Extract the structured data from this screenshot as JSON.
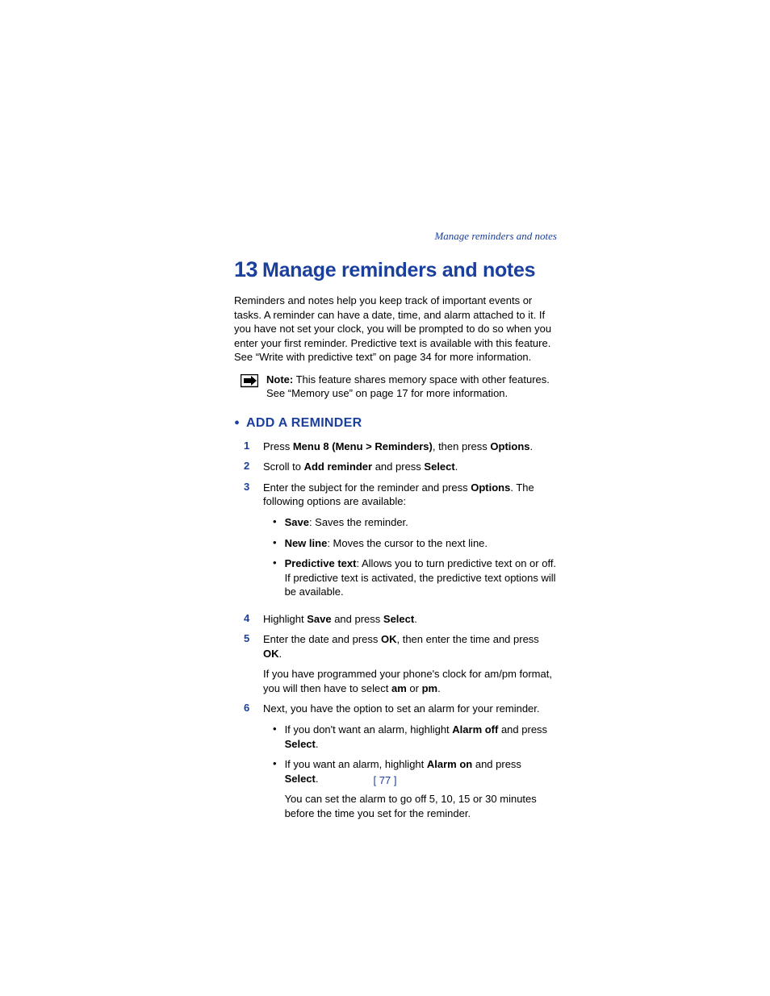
{
  "header": {
    "breadcrumb": "Manage reminders and notes"
  },
  "title": {
    "number": "13",
    "text": "Manage reminders and notes"
  },
  "intro": "Reminders and notes help you keep track of important events or tasks. A reminder can have a date, time, and alarm attached to it. If you have not set your clock, you will be prompted to do so when you enter your first reminder. Predictive text is available with this feature. See “Write with predictive text” on page 34 for more information.",
  "note": {
    "label": "Note:",
    "text": " This feature shares memory space with other features. See “Memory use” on page 17 for more information."
  },
  "section": {
    "heading": "ADD A REMINDER"
  },
  "steps": [
    {
      "n": "1",
      "parts": [
        "Press ",
        "Menu 8 (Menu > Reminders)",
        ", then press ",
        "Options",
        "."
      ],
      "bold": [
        1,
        3
      ]
    },
    {
      "n": "2",
      "parts": [
        "Scroll to ",
        "Add reminder",
        " and press ",
        "Select",
        "."
      ],
      "bold": [
        1,
        3
      ]
    },
    {
      "n": "3",
      "parts": [
        "Enter the subject for the reminder and press ",
        "Options",
        ". The following options are available:"
      ],
      "bold": [
        1
      ],
      "sub": [
        {
          "parts": [
            "Save",
            ": Saves the reminder."
          ],
          "bold": [
            0
          ]
        },
        {
          "parts": [
            "New line",
            ": Moves the cursor to the next line."
          ],
          "bold": [
            0
          ]
        },
        {
          "parts": [
            "Predictive text",
            ": Allows you to turn predictive text on or off. If predictive text is activated, the predictive text options will be available."
          ],
          "bold": [
            0
          ]
        }
      ]
    },
    {
      "n": "4",
      "parts": [
        "Highlight ",
        "Save",
        " and press ",
        "Select",
        "."
      ],
      "bold": [
        1,
        3
      ]
    },
    {
      "n": "5",
      "parts": [
        "Enter the date and press ",
        "OK",
        ", then enter the time and press ",
        "OK",
        "."
      ],
      "bold": [
        1,
        3
      ],
      "extra": {
        "parts": [
          "If you have programmed your phone's clock for am/pm format, you will then have to select ",
          "am",
          " or ",
          "pm",
          "."
        ],
        "bold": [
          1,
          3
        ]
      }
    },
    {
      "n": "6",
      "parts": [
        "Next, you have the option to set an alarm for your reminder."
      ],
      "bold": [],
      "sub": [
        {
          "parts": [
            "If you don't want an alarm, highlight ",
            "Alarm off",
            " and press ",
            "Select",
            "."
          ],
          "bold": [
            1,
            3
          ]
        },
        {
          "parts": [
            "If you want an alarm, highlight ",
            "Alarm on",
            " and press ",
            "Select",
            "."
          ],
          "bold": [
            1,
            3
          ],
          "extra": "You can set the alarm to go off 5, 10, 15 or 30 minutes before the time you set for the reminder."
        }
      ]
    }
  ],
  "pagenum": "[ 77 ]"
}
